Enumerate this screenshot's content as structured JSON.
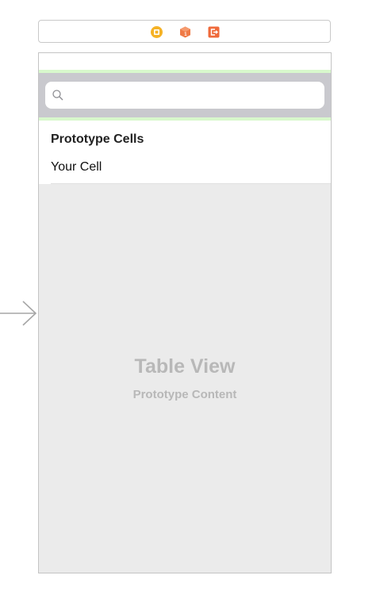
{
  "scene_dock": {
    "icons": [
      "view-controller-icon",
      "first-responder-icon",
      "exit-icon"
    ],
    "colors": {
      "view_controller": "#F5B225",
      "first_responder": "#EF7A46",
      "exit": "#EF6A3B"
    }
  },
  "search": {
    "value": "",
    "placeholder": ""
  },
  "cells": {
    "header": "Prototype Cells",
    "items": [
      {
        "label": "Your Cell"
      }
    ]
  },
  "table_view": {
    "title": "Table View",
    "subtitle": "Prototype Content"
  },
  "colors": {
    "search_bar_bg": "#C9C9CE",
    "table_bg": "#EBEBEB",
    "layout_guide": "#D8F8CC",
    "placeholder_text": "#B8B8B8"
  }
}
